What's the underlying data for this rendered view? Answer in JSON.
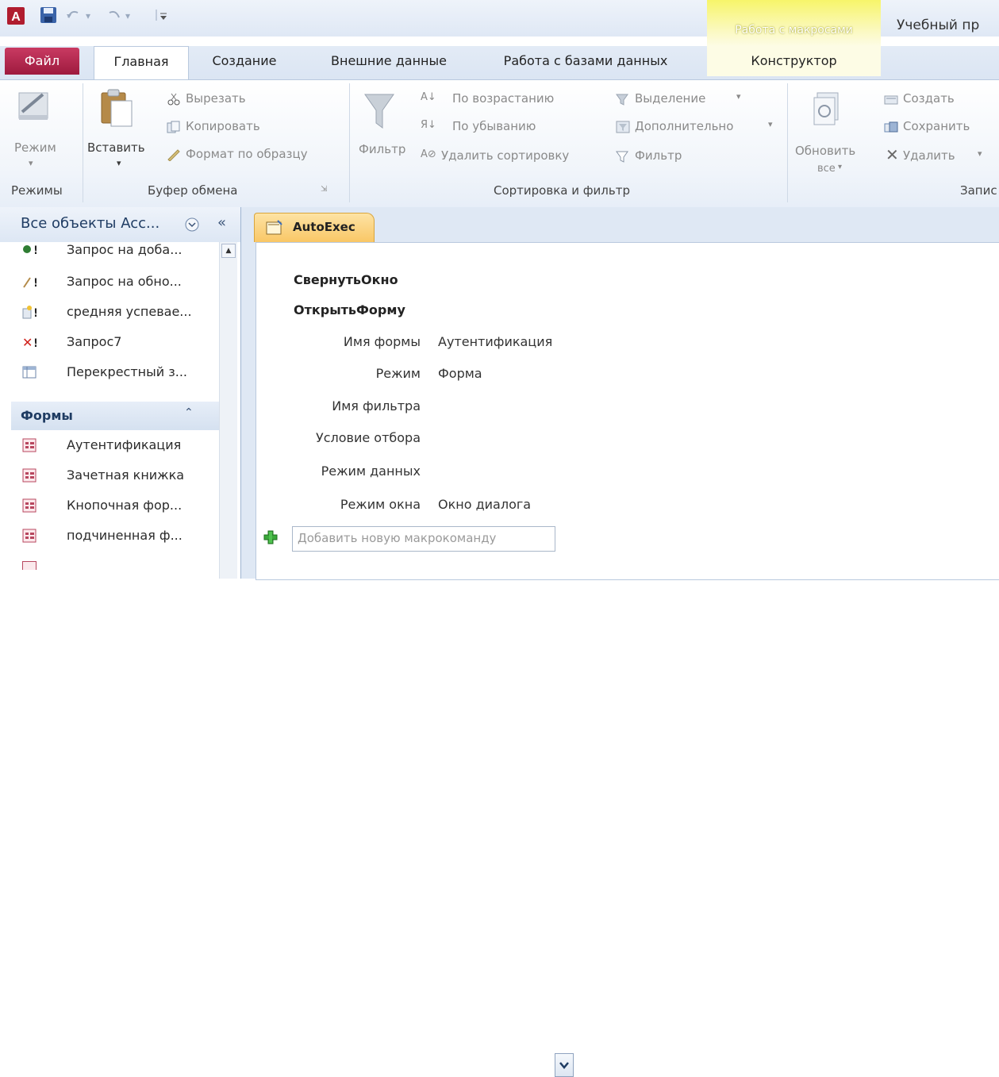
{
  "titlebar": {
    "context_tab_title": "Работа с макросами",
    "app_title": "Учебный пр"
  },
  "tabs": {
    "file": "Файл",
    "home": "Главная",
    "create": "Создание",
    "external": "Внешние данные",
    "database": "Работа с базами данных",
    "designer": "Конструктор"
  },
  "ribbon": {
    "views": {
      "mode": "Режим",
      "group": "Режимы"
    },
    "clipboard": {
      "paste": "Вставить",
      "cut": "Вырезать",
      "copy": "Копировать",
      "format_painter": "Формат по образцу",
      "group": "Буфер обмена"
    },
    "sort_filter": {
      "filter": "Фильтр",
      "ascending": "По возрастанию",
      "descending": "По убыванию",
      "remove_sort": "Удалить сортировку",
      "selection": "Выделение",
      "advanced": "Дополнительно",
      "toggle_filter": "Фильтр",
      "group": "Сортировка и фильтр"
    },
    "records": {
      "refresh": "Обновить",
      "refresh_all": "все",
      "new": "Создать",
      "save": "Сохранить",
      "delete": "Удалить",
      "group": "Запис"
    }
  },
  "nav": {
    "title": "Все объекты Acc...",
    "items": [
      {
        "label": "Запрос на доба...",
        "icon": "append-query-icon"
      },
      {
        "label": "Запрос на обно...",
        "icon": "update-query-icon"
      },
      {
        "label": "средняя успевае...",
        "icon": "make-table-query-icon"
      },
      {
        "label": "Запрос7",
        "icon": "delete-query-icon"
      },
      {
        "label": "Перекрестный з...",
        "icon": "crosstab-query-icon"
      }
    ],
    "forms_header": "Формы",
    "forms": [
      {
        "label": "Аутентификация",
        "icon": "form-icon"
      },
      {
        "label": "Зачетная книжка",
        "icon": "form-icon"
      },
      {
        "label": "Кнопочная фор...",
        "icon": "form-icon"
      },
      {
        "label": "подчиненная ф...",
        "icon": "form-icon"
      }
    ]
  },
  "document": {
    "tab_label": "AutoExec",
    "actions": [
      {
        "name": "СвернутьОкно"
      },
      {
        "name": "ОткрытьФорму"
      }
    ],
    "args": [
      {
        "name": "Имя формы",
        "value": "Аутентификация"
      },
      {
        "name": "Режим",
        "value": "Форма"
      },
      {
        "name": "Имя фильтра",
        "value": ""
      },
      {
        "name": "Условие отбора",
        "value": ""
      },
      {
        "name": "Режим данных",
        "value": ""
      },
      {
        "name": "Режим окна",
        "value": "Окно диалога"
      }
    ],
    "add_placeholder": "Добавить новую макрокоманду"
  },
  "colors": {
    "file_tab": "#b5284f",
    "context_tab": "#f7f56a",
    "doc_tab": "#f9c766",
    "nav_header": "#1f3c63"
  }
}
